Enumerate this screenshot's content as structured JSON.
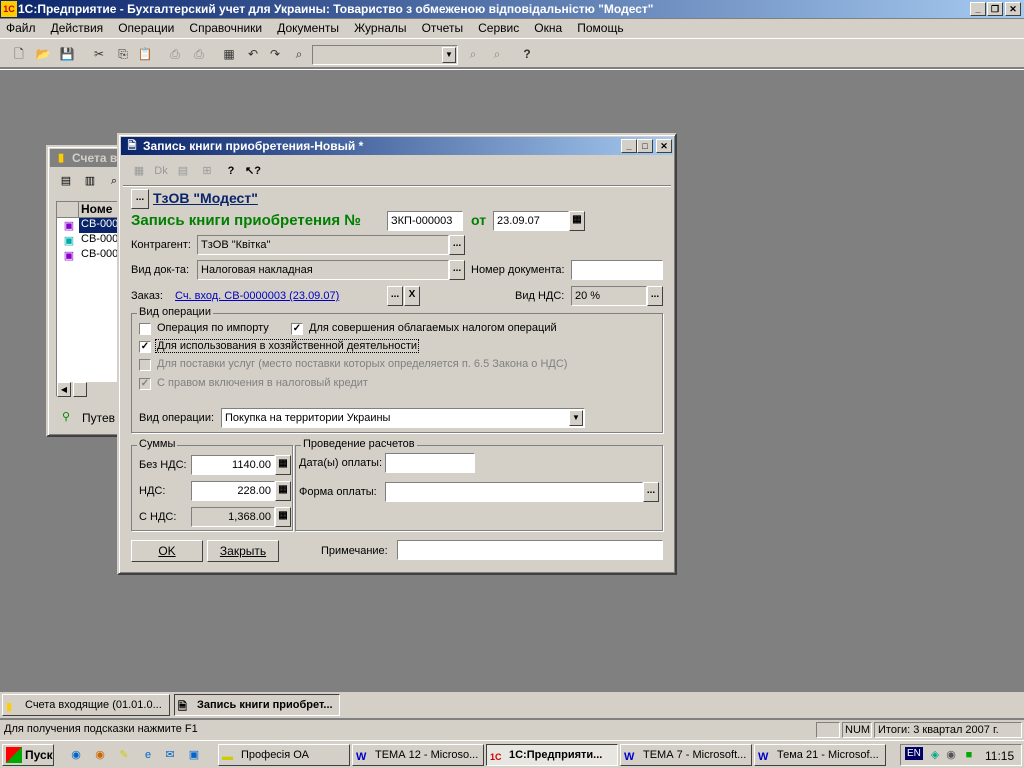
{
  "app": {
    "title": "1С:Предприятие - Бухгалтерский учет для Украины: Товариство з обмеженою відповідальністю \"Модест\"",
    "window_buttons": {
      "minimize": "_",
      "restore": "❐",
      "close": "✕"
    }
  },
  "menu": [
    "Файл",
    "Действия",
    "Операции",
    "Справочники",
    "Документы",
    "Журналы",
    "Отчеты",
    "Сервис",
    "Окна",
    "Помощь"
  ],
  "bg_window": {
    "title": "Счета в",
    "column_header": "Номе",
    "rows": [
      "СВ-000",
      "СВ-000",
      "СВ-000"
    ],
    "footer_label": "Путев"
  },
  "dialog": {
    "title": "Запись книги приобретения-Новый *",
    "company_link": "ТзОВ \"Модест\"",
    "company_btn": "...",
    "heading": "Запись книги приобретения №",
    "number": "ЗКП-000003",
    "date_label": "от",
    "date": "23.09.07",
    "contragent_label": "Контрагент:",
    "contragent_value": "ТзОВ \"Квітка\"",
    "doctype_label": "Вид док-та:",
    "doctype_value": "Налоговая накладная",
    "docnum_label": "Номер документа:",
    "docnum_value": "",
    "order_label": "Заказ:",
    "order_link": "Сч. вход. СВ-0000003 (23.09.07)",
    "vat_type_label": "Вид НДС:",
    "vat_type_value": "20 %",
    "ellipsis": "...",
    "clear": "X",
    "op_group_title": "Вид операции",
    "checkboxes": {
      "import": {
        "label": "Операция по импорту",
        "checked": false
      },
      "taxable": {
        "label": "Для совершения облагаемых налогом операций",
        "checked": true
      },
      "business": {
        "label": "Для использования в хозяйственной деятельности",
        "checked": true
      },
      "services": {
        "label": "Для поставки услуг (место поставки которых определяется п. 6.5 Закона о НДС)",
        "checked": false
      },
      "credit": {
        "label": "С правом включения в налоговый кредит",
        "checked": true
      }
    },
    "op_type_label": "Вид операции:",
    "op_type_value": "Покупка на территории Украины",
    "sums_title": "Суммы",
    "no_vat_label": "Без НДС:",
    "no_vat_value": "1140.00",
    "vat_label": "НДС:",
    "vat_value": "228.00",
    "with_vat_label": "С НДС:",
    "with_vat_value": "1,368.00",
    "payments_title": "Проведение расчетов",
    "pay_date_label": "Дата(ы) оплаты:",
    "pay_date_value": "",
    "pay_form_label": "Форма оплаты:",
    "pay_form_value": "",
    "ok": "OK",
    "close": "Закрыть",
    "note_label": "Примечание:",
    "note_value": ""
  },
  "mdi_tabs": [
    {
      "label": "Счета входящие (01.01.0..."
    },
    {
      "label": "Запись книги приобрет..."
    }
  ],
  "status": {
    "hint": "Для получения подсказки нажмите F1",
    "num": "NUM",
    "totals": "Итоги: 3 квартал 2007 г."
  },
  "taskbar": {
    "start": "Пуск",
    "items": [
      {
        "label": "Професія ОА"
      },
      {
        "label": "ТЕМА 12 - Microso..."
      },
      {
        "label": "1С:Предприяти..."
      },
      {
        "label": "ТЕМА 7 - Microsoft..."
      },
      {
        "label": "Тема 21 - Microsof..."
      }
    ],
    "lang": "EN",
    "clock": "11:15"
  }
}
